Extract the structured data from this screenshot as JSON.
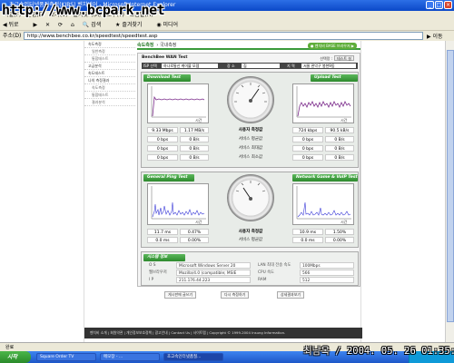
{
  "watermark": "http://www.bcpark.net",
  "timestamp": "최남옥 / 2004. 05. 26 01:35:53",
  "window": {
    "title": "초고속인터넷품질측정(KIBS) 벤치비어 - Microsoft Internet Explorer"
  },
  "menu": [
    "파일(F)",
    "편집(E)",
    "보기(V)",
    "즐겨찾기(A)",
    "도구(T)",
    "도움말(H)"
  ],
  "toolbar": {
    "back": "뒤로",
    "search": "검색",
    "favorites": "즐겨찾기",
    "media": "미디어"
  },
  "address": {
    "label": "주소(D)",
    "url": "http://www.benchbee.co.kr/speedtest/speedtest.asp",
    "go": "이동"
  },
  "sidebar": [
    "속도측정",
    "일반측정",
    "통합테스트",
    "고급분석",
    "속도테스트",
    "나의 측정결과",
    "속도측정",
    "통합테스트",
    "결과분석"
  ],
  "page": {
    "breadcrumb_bold": "속도측정",
    "breadcrumb": "국내측정",
    "top_button": "● 벤치비 BASE 브라우저 ▶",
    "wan_title": "BenchBee WAN Test",
    "server_label": "선택망 :",
    "server_value": "테스트 설",
    "isp_label": "ISP 선택",
    "isp_value": "하나로통신 케이블 모뎀",
    "place_label": "장 소",
    "place_value": "집",
    "region_label": "지 역",
    "region_value": "서울 관악구 봉천9동"
  },
  "download": {
    "label": "Download Test",
    "axis_label": "시간",
    "stats": [
      [
        "9.33 Mbps",
        "1.17 MB/s"
      ],
      [
        "0 bps",
        "0 B/s"
      ],
      [
        "0 bps",
        "0 B/s"
      ],
      [
        "0 bps",
        "0 B/s"
      ]
    ]
  },
  "upload": {
    "label": "Upload Test",
    "axis_label": "시간",
    "stats": [
      [
        "724 kbps",
        "90.5 kB/s"
      ],
      [
        "0 bps",
        "0 B/s"
      ],
      [
        "0 bps",
        "0 B/s"
      ],
      [
        "0 bps",
        "0 B/s"
      ]
    ]
  },
  "speed_labels": [
    "사용자 측정값",
    "서비스 평균값",
    "서비스 최대값",
    "서비스 최소값"
  ],
  "ping": {
    "label": "General Ping Test",
    "side_label": "지연",
    "axis_label": "시간",
    "stats": [
      [
        "11.7 ms",
        "0.47%"
      ],
      [
        "0.0 ms",
        "0.00%"
      ]
    ]
  },
  "game": {
    "label": "Network Game & VoIP Test",
    "side_label": "지연",
    "axis_label": "시간",
    "stats": [
      [
        "10.9 ms",
        "1.50%"
      ],
      [
        "0.0 ms",
        "0.00%"
      ]
    ]
  },
  "ping_labels": [
    "사용자 측정값",
    "서비스 평균값"
  ],
  "sysinfo": {
    "label": "시스템 정보",
    "rows": [
      {
        "l1": "O S",
        "v1": "Microsoft Windows Server 20",
        "l2": "LAN 최대 전송 속도",
        "v2": "100Mbps"
      },
      {
        "l1": "웹브라우저",
        "v1": "Mozilla/4.0 (compatible; MSIE",
        "l2": "CPU 속도",
        "v2": "566"
      },
      {
        "l1": "I P",
        "v1": "211.176.44.223",
        "l2": "RAM",
        "v2": "512"
      }
    ]
  },
  "buttons": [
    "게시판에 글쓰기",
    "다시 측정하기",
    "상세결과보기"
  ],
  "footer": "벤치비 소개 | 회원약관 | 개인정보보호정책 | 광고안내 | Contact Us | 사이트맵 | Copyright © 1999-2004 Insung Information.",
  "status": "완료",
  "taskbar": {
    "start": "시작",
    "tasks": [
      "Square Order TV",
      "메모장 - ...",
      "초고속인터넷품질..."
    ]
  },
  "colors": {
    "accent_green": "#3a9a3a",
    "download_line": "#7a2a8a",
    "ping_line": "#3b3bd8"
  }
}
